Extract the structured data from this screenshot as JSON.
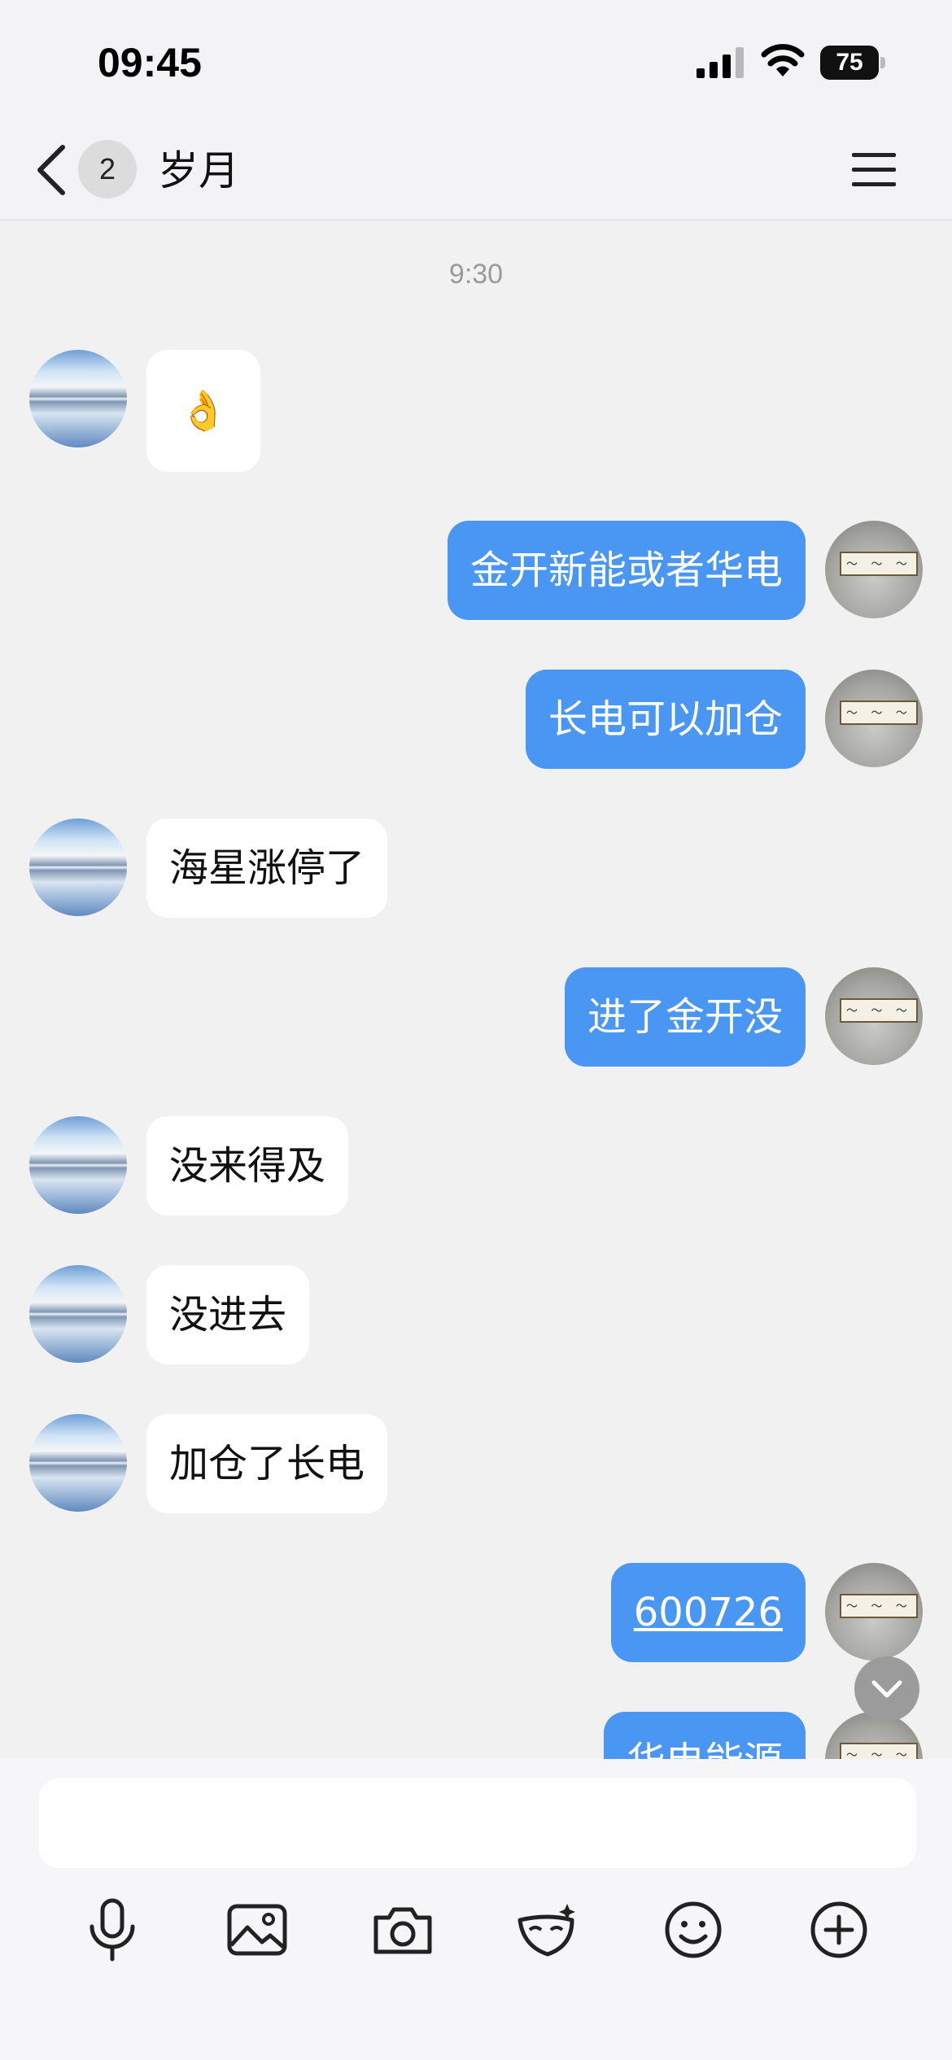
{
  "status_bar": {
    "time": "09:45",
    "battery": "75"
  },
  "nav": {
    "unread_count": "2",
    "title": "岁月"
  },
  "chat": {
    "timestamp": "9:30",
    "messages": [
      {
        "direction": "in",
        "text": "👌"
      },
      {
        "direction": "out",
        "text": "金开新能或者华电"
      },
      {
        "direction": "out",
        "text": "长电可以加仓"
      },
      {
        "direction": "in",
        "text": "海星涨停了"
      },
      {
        "direction": "out",
        "text": "进了金开没"
      },
      {
        "direction": "in",
        "text": "没来得及"
      },
      {
        "direction": "in",
        "text": "没进去"
      },
      {
        "direction": "in",
        "text": "加仓了长电"
      },
      {
        "direction": "out",
        "text": "600726"
      },
      {
        "direction": "out",
        "text": "华电能源"
      }
    ]
  },
  "composer": {
    "placeholder": ""
  },
  "toolbar": [
    "microphone-icon",
    "image-icon",
    "camera-icon",
    "mask-icon",
    "emoji-icon",
    "plus-icon"
  ],
  "colors": {
    "outgoing_bubble": "#4a97f3",
    "incoming_bubble": "#ffffff",
    "background": "#f1f1f1"
  }
}
